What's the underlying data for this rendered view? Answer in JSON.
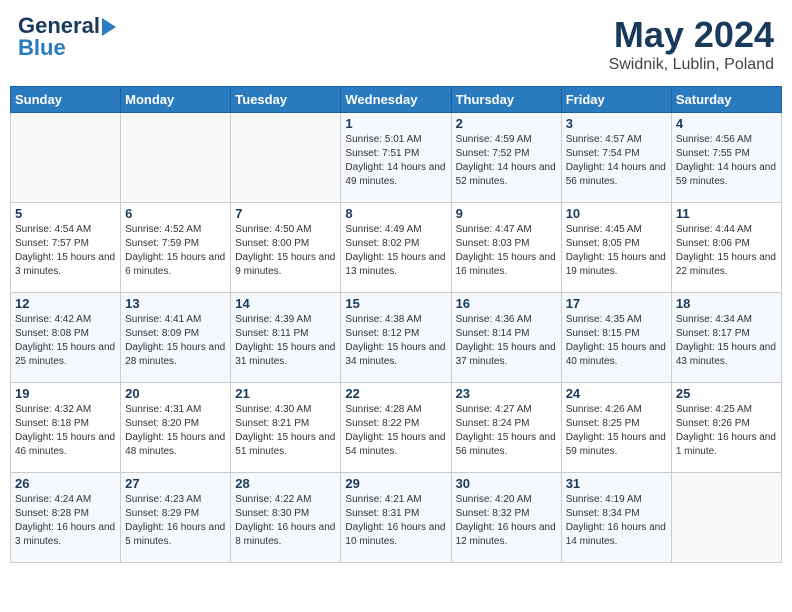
{
  "header": {
    "logo_line1": "General",
    "logo_line2": "Blue",
    "month": "May 2024",
    "location": "Swidnik, Lublin, Poland"
  },
  "days_of_week": [
    "Sunday",
    "Monday",
    "Tuesday",
    "Wednesday",
    "Thursday",
    "Friday",
    "Saturday"
  ],
  "weeks": [
    [
      {
        "day": "",
        "sunrise": "",
        "sunset": "",
        "daylight": ""
      },
      {
        "day": "",
        "sunrise": "",
        "sunset": "",
        "daylight": ""
      },
      {
        "day": "",
        "sunrise": "",
        "sunset": "",
        "daylight": ""
      },
      {
        "day": "1",
        "sunrise": "Sunrise: 5:01 AM",
        "sunset": "Sunset: 7:51 PM",
        "daylight": "Daylight: 14 hours and 49 minutes."
      },
      {
        "day": "2",
        "sunrise": "Sunrise: 4:59 AM",
        "sunset": "Sunset: 7:52 PM",
        "daylight": "Daylight: 14 hours and 52 minutes."
      },
      {
        "day": "3",
        "sunrise": "Sunrise: 4:57 AM",
        "sunset": "Sunset: 7:54 PM",
        "daylight": "Daylight: 14 hours and 56 minutes."
      },
      {
        "day": "4",
        "sunrise": "Sunrise: 4:56 AM",
        "sunset": "Sunset: 7:55 PM",
        "daylight": "Daylight: 14 hours and 59 minutes."
      }
    ],
    [
      {
        "day": "5",
        "sunrise": "Sunrise: 4:54 AM",
        "sunset": "Sunset: 7:57 PM",
        "daylight": "Daylight: 15 hours and 3 minutes."
      },
      {
        "day": "6",
        "sunrise": "Sunrise: 4:52 AM",
        "sunset": "Sunset: 7:59 PM",
        "daylight": "Daylight: 15 hours and 6 minutes."
      },
      {
        "day": "7",
        "sunrise": "Sunrise: 4:50 AM",
        "sunset": "Sunset: 8:00 PM",
        "daylight": "Daylight: 15 hours and 9 minutes."
      },
      {
        "day": "8",
        "sunrise": "Sunrise: 4:49 AM",
        "sunset": "Sunset: 8:02 PM",
        "daylight": "Daylight: 15 hours and 13 minutes."
      },
      {
        "day": "9",
        "sunrise": "Sunrise: 4:47 AM",
        "sunset": "Sunset: 8:03 PM",
        "daylight": "Daylight: 15 hours and 16 minutes."
      },
      {
        "day": "10",
        "sunrise": "Sunrise: 4:45 AM",
        "sunset": "Sunset: 8:05 PM",
        "daylight": "Daylight: 15 hours and 19 minutes."
      },
      {
        "day": "11",
        "sunrise": "Sunrise: 4:44 AM",
        "sunset": "Sunset: 8:06 PM",
        "daylight": "Daylight: 15 hours and 22 minutes."
      }
    ],
    [
      {
        "day": "12",
        "sunrise": "Sunrise: 4:42 AM",
        "sunset": "Sunset: 8:08 PM",
        "daylight": "Daylight: 15 hours and 25 minutes."
      },
      {
        "day": "13",
        "sunrise": "Sunrise: 4:41 AM",
        "sunset": "Sunset: 8:09 PM",
        "daylight": "Daylight: 15 hours and 28 minutes."
      },
      {
        "day": "14",
        "sunrise": "Sunrise: 4:39 AM",
        "sunset": "Sunset: 8:11 PM",
        "daylight": "Daylight: 15 hours and 31 minutes."
      },
      {
        "day": "15",
        "sunrise": "Sunrise: 4:38 AM",
        "sunset": "Sunset: 8:12 PM",
        "daylight": "Daylight: 15 hours and 34 minutes."
      },
      {
        "day": "16",
        "sunrise": "Sunrise: 4:36 AM",
        "sunset": "Sunset: 8:14 PM",
        "daylight": "Daylight: 15 hours and 37 minutes."
      },
      {
        "day": "17",
        "sunrise": "Sunrise: 4:35 AM",
        "sunset": "Sunset: 8:15 PM",
        "daylight": "Daylight: 15 hours and 40 minutes."
      },
      {
        "day": "18",
        "sunrise": "Sunrise: 4:34 AM",
        "sunset": "Sunset: 8:17 PM",
        "daylight": "Daylight: 15 hours and 43 minutes."
      }
    ],
    [
      {
        "day": "19",
        "sunrise": "Sunrise: 4:32 AM",
        "sunset": "Sunset: 8:18 PM",
        "daylight": "Daylight: 15 hours and 46 minutes."
      },
      {
        "day": "20",
        "sunrise": "Sunrise: 4:31 AM",
        "sunset": "Sunset: 8:20 PM",
        "daylight": "Daylight: 15 hours and 48 minutes."
      },
      {
        "day": "21",
        "sunrise": "Sunrise: 4:30 AM",
        "sunset": "Sunset: 8:21 PM",
        "daylight": "Daylight: 15 hours and 51 minutes."
      },
      {
        "day": "22",
        "sunrise": "Sunrise: 4:28 AM",
        "sunset": "Sunset: 8:22 PM",
        "daylight": "Daylight: 15 hours and 54 minutes."
      },
      {
        "day": "23",
        "sunrise": "Sunrise: 4:27 AM",
        "sunset": "Sunset: 8:24 PM",
        "daylight": "Daylight: 15 hours and 56 minutes."
      },
      {
        "day": "24",
        "sunrise": "Sunrise: 4:26 AM",
        "sunset": "Sunset: 8:25 PM",
        "daylight": "Daylight: 15 hours and 59 minutes."
      },
      {
        "day": "25",
        "sunrise": "Sunrise: 4:25 AM",
        "sunset": "Sunset: 8:26 PM",
        "daylight": "Daylight: 16 hours and 1 minute."
      }
    ],
    [
      {
        "day": "26",
        "sunrise": "Sunrise: 4:24 AM",
        "sunset": "Sunset: 8:28 PM",
        "daylight": "Daylight: 16 hours and 3 minutes."
      },
      {
        "day": "27",
        "sunrise": "Sunrise: 4:23 AM",
        "sunset": "Sunset: 8:29 PM",
        "daylight": "Daylight: 16 hours and 5 minutes."
      },
      {
        "day": "28",
        "sunrise": "Sunrise: 4:22 AM",
        "sunset": "Sunset: 8:30 PM",
        "daylight": "Daylight: 16 hours and 8 minutes."
      },
      {
        "day": "29",
        "sunrise": "Sunrise: 4:21 AM",
        "sunset": "Sunset: 8:31 PM",
        "daylight": "Daylight: 16 hours and 10 minutes."
      },
      {
        "day": "30",
        "sunrise": "Sunrise: 4:20 AM",
        "sunset": "Sunset: 8:32 PM",
        "daylight": "Daylight: 16 hours and 12 minutes."
      },
      {
        "day": "31",
        "sunrise": "Sunrise: 4:19 AM",
        "sunset": "Sunset: 8:34 PM",
        "daylight": "Daylight: 16 hours and 14 minutes."
      },
      {
        "day": "",
        "sunrise": "",
        "sunset": "",
        "daylight": ""
      }
    ]
  ]
}
